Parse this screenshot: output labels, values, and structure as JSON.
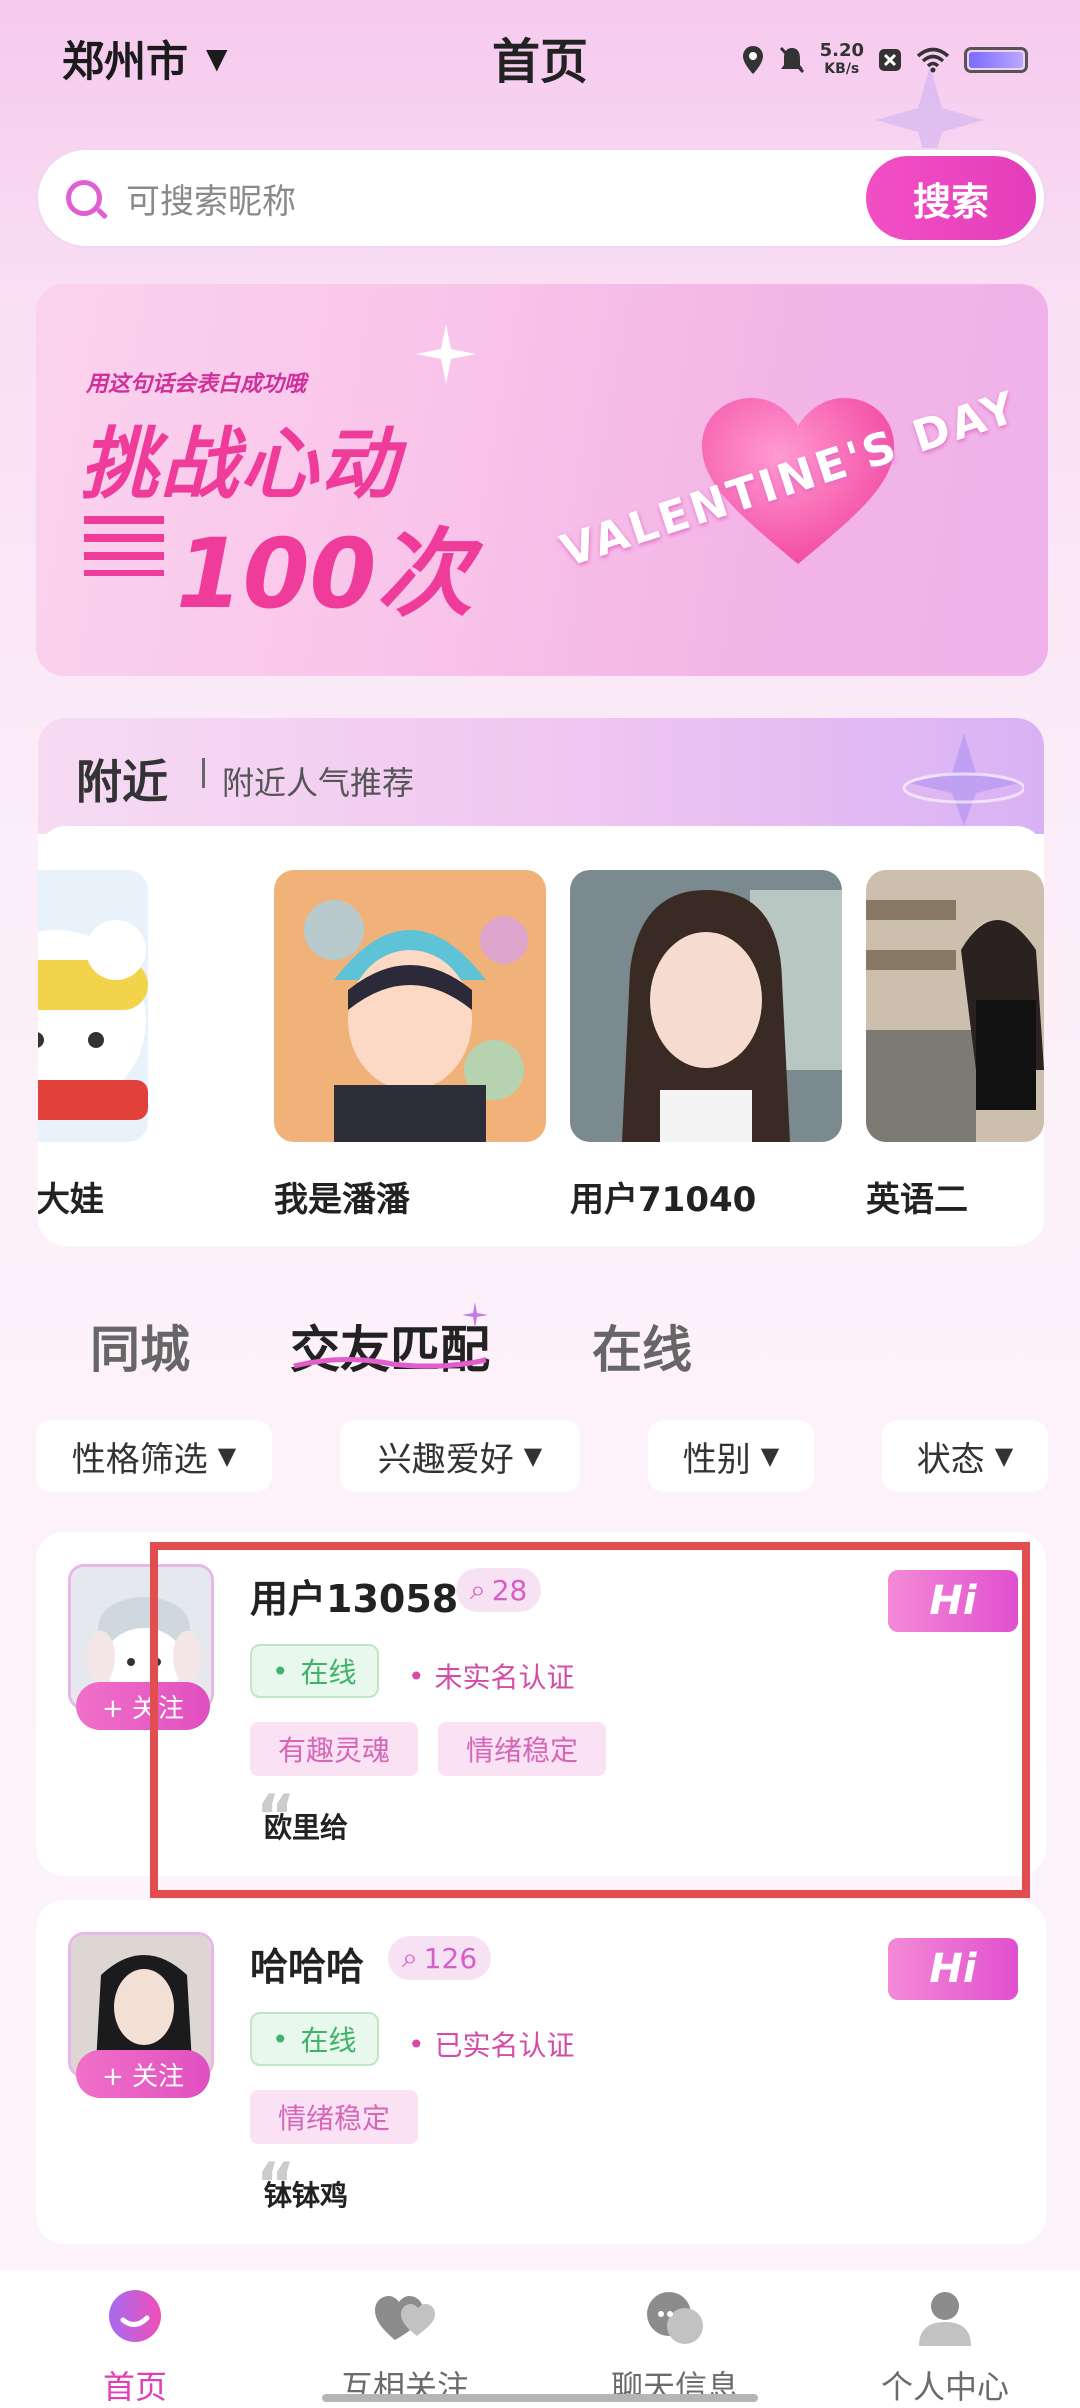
{
  "status_bar": {
    "city": "郑州市",
    "title": "首页",
    "net_speed_value": "5.20",
    "net_speed_unit": "KB/s"
  },
  "search": {
    "placeholder": "可搜索昵称",
    "button": "搜索"
  },
  "banner": {
    "subtitle": "用这句话会表白成功哦",
    "headline1": "挑战心动",
    "headline2": "100次",
    "ribbon_text": "VALENTINE'S DAY"
  },
  "nearby": {
    "title": "附近",
    "subtitle": "附近人气推荐",
    "people": [
      {
        "name": "大娃"
      },
      {
        "name": "我是潘潘"
      },
      {
        "name": "用户71040"
      },
      {
        "name": "英语二"
      }
    ]
  },
  "tabs": [
    {
      "label": "同城",
      "active": false
    },
    {
      "label": "交友匹配",
      "active": true
    },
    {
      "label": "在线",
      "active": false
    }
  ],
  "filters": [
    {
      "label": "性格筛选"
    },
    {
      "label": "兴趣爱好"
    },
    {
      "label": "性别"
    },
    {
      "label": "状态"
    }
  ],
  "users": [
    {
      "name": "用户13058",
      "count": "28",
      "follow": "+ 关注",
      "hi": "Hi",
      "online": "在线",
      "verify": "未实名认证",
      "tags": [
        "有趣灵魂",
        "情绪稳定"
      ],
      "quote": "欧里给"
    },
    {
      "name": "哈哈哈",
      "count": "126",
      "follow": "+ 关注",
      "hi": "Hi",
      "online": "在线",
      "verify": "已实名认证",
      "tags": [
        "情绪稳定"
      ],
      "quote": "钵钵鸡"
    }
  ],
  "bottom_nav": [
    {
      "label": "首页",
      "icon": "home-chat-icon",
      "active": true
    },
    {
      "label": "互相关注",
      "icon": "hearts-icon",
      "active": false
    },
    {
      "label": "聊天信息",
      "icon": "chat-bubbles-icon",
      "active": false
    },
    {
      "label": "个人中心",
      "icon": "person-icon",
      "active": false
    }
  ],
  "colors": {
    "accent": "#e03fb8",
    "online_green": "#3db467",
    "highlight_red": "#e24e50"
  }
}
